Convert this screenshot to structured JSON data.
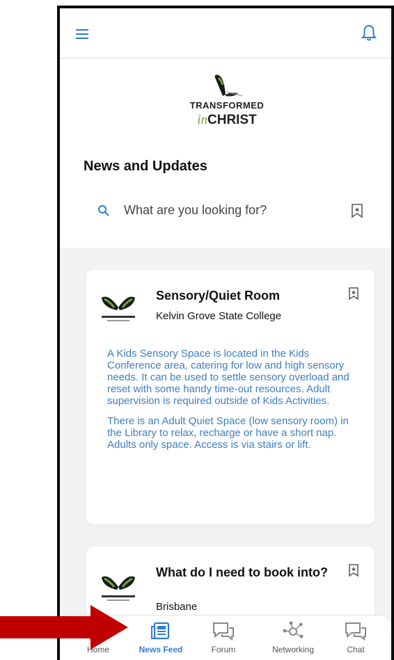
{
  "header": {
    "menu_icon": "hamburger-menu-icon",
    "notification_icon": "bell-icon"
  },
  "logo": {
    "line1": "TRANSFORMED",
    "line2_prefix": "in",
    "line2_main": "CHRIST"
  },
  "page": {
    "title": "News and Updates"
  },
  "search": {
    "placeholder": "What are you looking for?"
  },
  "posts": [
    {
      "title": "Sensory/Quiet Room",
      "subtitle": "Kelvin Grove State College",
      "paragraphs": [
        "A Kids Sensory Space is located in the Kids Conference area, catering for low and high sensory needs. It can be used to settle sensory overload and reset with some handy time-out resources. Adult supervision is required outside of Kids Activities.",
        "There is an Adult Quiet Space (low sensory room) in the Library to relax, recharge or have a short nap. Adults only space. Access is via stairs or lift."
      ]
    },
    {
      "title": "What do I need to book into?",
      "subtitle": "Brisbane"
    }
  ],
  "nav": {
    "items": [
      {
        "label": "Home",
        "icon": "home-icon"
      },
      {
        "label": "News Feed",
        "icon": "newspaper-icon",
        "active": true
      },
      {
        "label": "Forum",
        "icon": "chat-bubbles-icon"
      },
      {
        "label": "Networking",
        "icon": "network-icon"
      },
      {
        "label": "Chat",
        "icon": "chat-bubbles-icon"
      }
    ]
  },
  "colors": {
    "accent": "#2c7cd0",
    "body_text": "#3b7fc2",
    "arrow": "#c00000"
  }
}
